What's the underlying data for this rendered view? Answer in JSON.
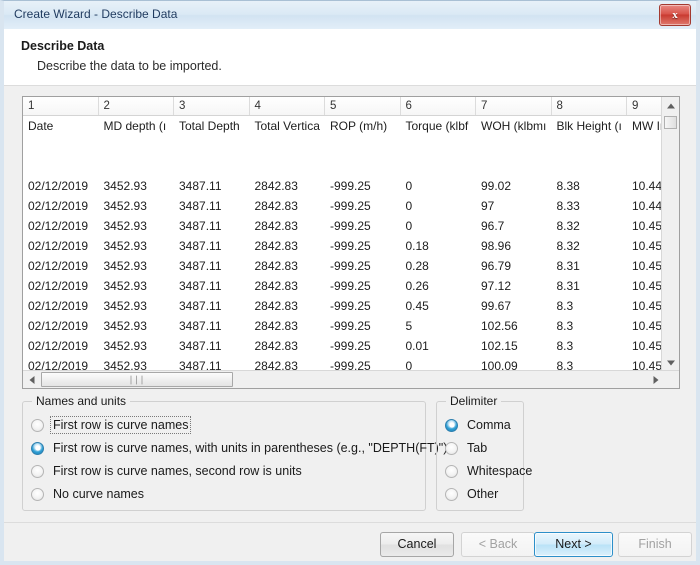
{
  "window": {
    "title": "Create Wizard - Describe Data",
    "close_icon": "close-icon",
    "close_glyph": "x"
  },
  "header": {
    "title": "Describe Data",
    "subtitle": "Describe the data to be imported."
  },
  "grid": {
    "column_numbers": [
      "1",
      "2",
      "3",
      "4",
      "5",
      "6",
      "7",
      "8",
      "9"
    ],
    "curve_names": [
      "Date",
      "MD depth (ı",
      "Total Depth",
      "Total Vertica",
      "ROP (m/h)",
      "Torque (klbf",
      "WOH (klbmı",
      "Blk Height (ı",
      "MW In"
    ],
    "blank_rows": 2,
    "rows": [
      [
        "02/12/2019",
        "3452.93",
        "3487.11",
        "2842.83",
        "-999.25",
        "0",
        "99.02",
        "8.38",
        "10.44"
      ],
      [
        "02/12/2019",
        "3452.93",
        "3487.11",
        "2842.83",
        "-999.25",
        "0",
        "97",
        "8.33",
        "10.44"
      ],
      [
        "02/12/2019",
        "3452.93",
        "3487.11",
        "2842.83",
        "-999.25",
        "0",
        "96.7",
        "8.32",
        "10.45"
      ],
      [
        "02/12/2019",
        "3452.93",
        "3487.11",
        "2842.83",
        "-999.25",
        "0.18",
        "98.96",
        "8.32",
        "10.45"
      ],
      [
        "02/12/2019",
        "3452.93",
        "3487.11",
        "2842.83",
        "-999.25",
        "0.28",
        "96.79",
        "8.31",
        "10.45"
      ],
      [
        "02/12/2019",
        "3452.93",
        "3487.11",
        "2842.83",
        "-999.25",
        "0.26",
        "97.12",
        "8.31",
        "10.45"
      ],
      [
        "02/12/2019",
        "3452.93",
        "3487.11",
        "2842.83",
        "-999.25",
        "0.45",
        "99.67",
        "8.3",
        "10.45"
      ],
      [
        "02/12/2019",
        "3452.93",
        "3487.11",
        "2842.83",
        "-999.25",
        "5",
        "102.56",
        "8.3",
        "10.45"
      ],
      [
        "02/12/2019",
        "3452.93",
        "3487.11",
        "2842.83",
        "-999.25",
        "0.01",
        "102.15",
        "8.3",
        "10.45"
      ],
      [
        "02/12/2019",
        "3452.93",
        "3487.11",
        "2842.83",
        "-999.25",
        "0",
        "100.09",
        "8.3",
        "10.45"
      ]
    ],
    "vscroll": {
      "up_icon": "scroll-up-arrow-icon",
      "down_icon": "scroll-down-arrow-icon"
    },
    "hscroll": {
      "left_icon": "scroll-left-arrow-icon",
      "right_icon": "scroll-right-arrow-icon",
      "grip": "∣∣∣"
    }
  },
  "names_group": {
    "legend": "Names and units",
    "options": [
      {
        "label": "First row is curve names",
        "checked": false,
        "focused": true
      },
      {
        "label": "First row is curve names, with units in parentheses (e.g., \"DEPTH(FT)\")",
        "checked": true,
        "focused": false
      },
      {
        "label": "First row is curve names, second row is units",
        "checked": false,
        "focused": false
      },
      {
        "label": "No curve names",
        "checked": false,
        "focused": false
      }
    ]
  },
  "delimiter_group": {
    "legend": "Delimiter",
    "options": [
      {
        "label": "Comma",
        "checked": true
      },
      {
        "label": "Tab",
        "checked": false
      },
      {
        "label": "Whitespace",
        "checked": false
      },
      {
        "label": "Other",
        "checked": false
      }
    ]
  },
  "buttons": {
    "cancel": {
      "label": "Cancel",
      "state": "enabled"
    },
    "back": {
      "label": "< Back",
      "state": "disabled"
    },
    "next": {
      "label": "Next >",
      "state": "default"
    },
    "finish": {
      "label": "Finish",
      "state": "disabled"
    }
  },
  "colors": {
    "accent": "#2c8fc9",
    "radio_checked": "#1d7fb5",
    "dialog_bg": "#f0f0f0",
    "close_button": "#c93b31",
    "titlebar": "#dae9f5"
  }
}
